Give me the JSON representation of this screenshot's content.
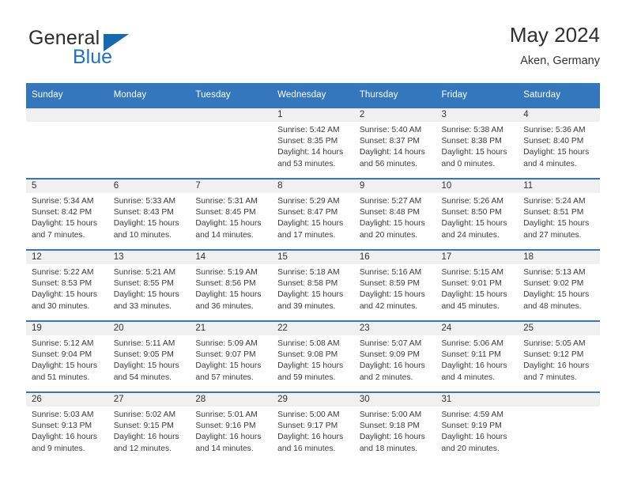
{
  "brand": {
    "name_top": "General",
    "name_bottom": "Blue",
    "accent_color": "#1668b0",
    "triangle_icon": "triangle-icon"
  },
  "header": {
    "title": "May 2024",
    "subtitle": "Aken, Germany"
  },
  "theme": {
    "header_blue": "#3477bc",
    "daynum_band": "#f0f0f0",
    "text": "#333333"
  },
  "weekday_headers": [
    "Sunday",
    "Monday",
    "Tuesday",
    "Wednesday",
    "Thursday",
    "Friday",
    "Saturday"
  ],
  "weeks": [
    [
      {
        "day": "",
        "empty": true
      },
      {
        "day": "",
        "empty": true
      },
      {
        "day": "",
        "empty": true
      },
      {
        "day": "1",
        "sunrise": "Sunrise: 5:42 AM",
        "sunset": "Sunset: 8:35 PM",
        "daylight_1": "Daylight: 14 hours",
        "daylight_2": "and 53 minutes."
      },
      {
        "day": "2",
        "sunrise": "Sunrise: 5:40 AM",
        "sunset": "Sunset: 8:37 PM",
        "daylight_1": "Daylight: 14 hours",
        "daylight_2": "and 56 minutes."
      },
      {
        "day": "3",
        "sunrise": "Sunrise: 5:38 AM",
        "sunset": "Sunset: 8:38 PM",
        "daylight_1": "Daylight: 15 hours",
        "daylight_2": "and 0 minutes."
      },
      {
        "day": "4",
        "sunrise": "Sunrise: 5:36 AM",
        "sunset": "Sunset: 8:40 PM",
        "daylight_1": "Daylight: 15 hours",
        "daylight_2": "and 4 minutes."
      }
    ],
    [
      {
        "day": "5",
        "sunrise": "Sunrise: 5:34 AM",
        "sunset": "Sunset: 8:42 PM",
        "daylight_1": "Daylight: 15 hours",
        "daylight_2": "and 7 minutes."
      },
      {
        "day": "6",
        "sunrise": "Sunrise: 5:33 AM",
        "sunset": "Sunset: 8:43 PM",
        "daylight_1": "Daylight: 15 hours",
        "daylight_2": "and 10 minutes."
      },
      {
        "day": "7",
        "sunrise": "Sunrise: 5:31 AM",
        "sunset": "Sunset: 8:45 PM",
        "daylight_1": "Daylight: 15 hours",
        "daylight_2": "and 14 minutes."
      },
      {
        "day": "8",
        "sunrise": "Sunrise: 5:29 AM",
        "sunset": "Sunset: 8:47 PM",
        "daylight_1": "Daylight: 15 hours",
        "daylight_2": "and 17 minutes."
      },
      {
        "day": "9",
        "sunrise": "Sunrise: 5:27 AM",
        "sunset": "Sunset: 8:48 PM",
        "daylight_1": "Daylight: 15 hours",
        "daylight_2": "and 20 minutes."
      },
      {
        "day": "10",
        "sunrise": "Sunrise: 5:26 AM",
        "sunset": "Sunset: 8:50 PM",
        "daylight_1": "Daylight: 15 hours",
        "daylight_2": "and 24 minutes."
      },
      {
        "day": "11",
        "sunrise": "Sunrise: 5:24 AM",
        "sunset": "Sunset: 8:51 PM",
        "daylight_1": "Daylight: 15 hours",
        "daylight_2": "and 27 minutes."
      }
    ],
    [
      {
        "day": "12",
        "sunrise": "Sunrise: 5:22 AM",
        "sunset": "Sunset: 8:53 PM",
        "daylight_1": "Daylight: 15 hours",
        "daylight_2": "and 30 minutes."
      },
      {
        "day": "13",
        "sunrise": "Sunrise: 5:21 AM",
        "sunset": "Sunset: 8:55 PM",
        "daylight_1": "Daylight: 15 hours",
        "daylight_2": "and 33 minutes."
      },
      {
        "day": "14",
        "sunrise": "Sunrise: 5:19 AM",
        "sunset": "Sunset: 8:56 PM",
        "daylight_1": "Daylight: 15 hours",
        "daylight_2": "and 36 minutes."
      },
      {
        "day": "15",
        "sunrise": "Sunrise: 5:18 AM",
        "sunset": "Sunset: 8:58 PM",
        "daylight_1": "Daylight: 15 hours",
        "daylight_2": "and 39 minutes."
      },
      {
        "day": "16",
        "sunrise": "Sunrise: 5:16 AM",
        "sunset": "Sunset: 8:59 PM",
        "daylight_1": "Daylight: 15 hours",
        "daylight_2": "and 42 minutes."
      },
      {
        "day": "17",
        "sunrise": "Sunrise: 5:15 AM",
        "sunset": "Sunset: 9:01 PM",
        "daylight_1": "Daylight: 15 hours",
        "daylight_2": "and 45 minutes."
      },
      {
        "day": "18",
        "sunrise": "Sunrise: 5:13 AM",
        "sunset": "Sunset: 9:02 PM",
        "daylight_1": "Daylight: 15 hours",
        "daylight_2": "and 48 minutes."
      }
    ],
    [
      {
        "day": "19",
        "sunrise": "Sunrise: 5:12 AM",
        "sunset": "Sunset: 9:04 PM",
        "daylight_1": "Daylight: 15 hours",
        "daylight_2": "and 51 minutes."
      },
      {
        "day": "20",
        "sunrise": "Sunrise: 5:11 AM",
        "sunset": "Sunset: 9:05 PM",
        "daylight_1": "Daylight: 15 hours",
        "daylight_2": "and 54 minutes."
      },
      {
        "day": "21",
        "sunrise": "Sunrise: 5:09 AM",
        "sunset": "Sunset: 9:07 PM",
        "daylight_1": "Daylight: 15 hours",
        "daylight_2": "and 57 minutes."
      },
      {
        "day": "22",
        "sunrise": "Sunrise: 5:08 AM",
        "sunset": "Sunset: 9:08 PM",
        "daylight_1": "Daylight: 15 hours",
        "daylight_2": "and 59 minutes."
      },
      {
        "day": "23",
        "sunrise": "Sunrise: 5:07 AM",
        "sunset": "Sunset: 9:09 PM",
        "daylight_1": "Daylight: 16 hours",
        "daylight_2": "and 2 minutes."
      },
      {
        "day": "24",
        "sunrise": "Sunrise: 5:06 AM",
        "sunset": "Sunset: 9:11 PM",
        "daylight_1": "Daylight: 16 hours",
        "daylight_2": "and 4 minutes."
      },
      {
        "day": "25",
        "sunrise": "Sunrise: 5:05 AM",
        "sunset": "Sunset: 9:12 PM",
        "daylight_1": "Daylight: 16 hours",
        "daylight_2": "and 7 minutes."
      }
    ],
    [
      {
        "day": "26",
        "sunrise": "Sunrise: 5:03 AM",
        "sunset": "Sunset: 9:13 PM",
        "daylight_1": "Daylight: 16 hours",
        "daylight_2": "and 9 minutes."
      },
      {
        "day": "27",
        "sunrise": "Sunrise: 5:02 AM",
        "sunset": "Sunset: 9:15 PM",
        "daylight_1": "Daylight: 16 hours",
        "daylight_2": "and 12 minutes."
      },
      {
        "day": "28",
        "sunrise": "Sunrise: 5:01 AM",
        "sunset": "Sunset: 9:16 PM",
        "daylight_1": "Daylight: 16 hours",
        "daylight_2": "and 14 minutes."
      },
      {
        "day": "29",
        "sunrise": "Sunrise: 5:00 AM",
        "sunset": "Sunset: 9:17 PM",
        "daylight_1": "Daylight: 16 hours",
        "daylight_2": "and 16 minutes."
      },
      {
        "day": "30",
        "sunrise": "Sunrise: 5:00 AM",
        "sunset": "Sunset: 9:18 PM",
        "daylight_1": "Daylight: 16 hours",
        "daylight_2": "and 18 minutes."
      },
      {
        "day": "31",
        "sunrise": "Sunrise: 4:59 AM",
        "sunset": "Sunset: 9:19 PM",
        "daylight_1": "Daylight: 16 hours",
        "daylight_2": "and 20 minutes."
      },
      {
        "day": "",
        "empty": true
      }
    ]
  ]
}
